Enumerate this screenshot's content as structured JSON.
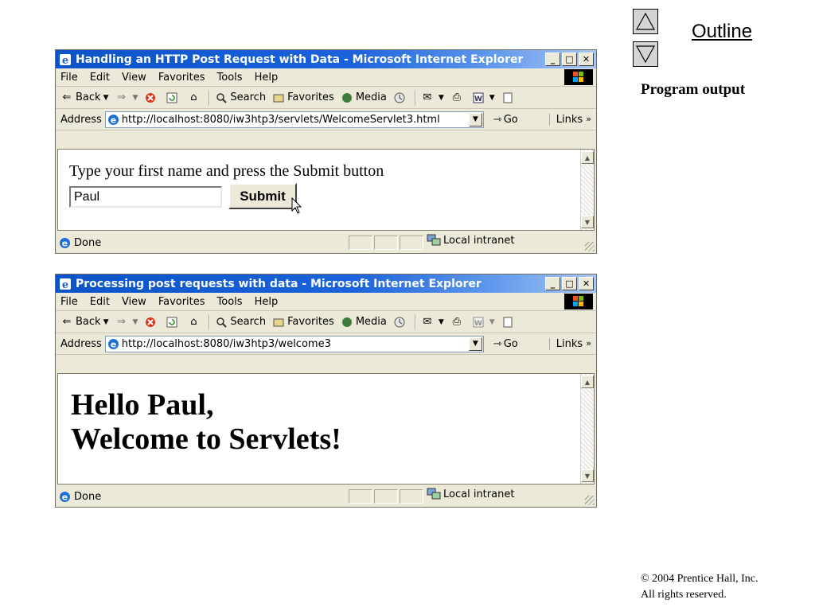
{
  "slide": {
    "outline_label": "Outline",
    "section_label": "Program output",
    "copyright_line1": "© 2004 Prentice Hall, Inc.",
    "copyright_line2": "All rights reserved."
  },
  "browser_common": {
    "menu": [
      "File",
      "Edit",
      "View",
      "Favorites",
      "Tools",
      "Help"
    ],
    "toolbar": {
      "back": "Back",
      "search": "Search",
      "favorites": "Favorites",
      "media": "Media"
    },
    "address_label": "Address",
    "go_label": "Go",
    "links_label": "Links",
    "status_text": "Done",
    "zone_text": "Local intranet"
  },
  "window1": {
    "title": "Handling an HTTP Post Request with Data - Microsoft Internet Explorer",
    "url": "http://localhost:8080/iw3htp3/servlets/WelcomeServlet3.html",
    "prompt_text": "Type your first name and press the Submit button",
    "name_value": "Paul",
    "submit_label": "Submit"
  },
  "window2": {
    "title": "Processing post requests with data - Microsoft Internet Explorer",
    "url": "http://localhost:8080/iw3htp3/welcome3",
    "greeting_line1": "Hello Paul,",
    "greeting_line2": "Welcome to Servlets!"
  }
}
